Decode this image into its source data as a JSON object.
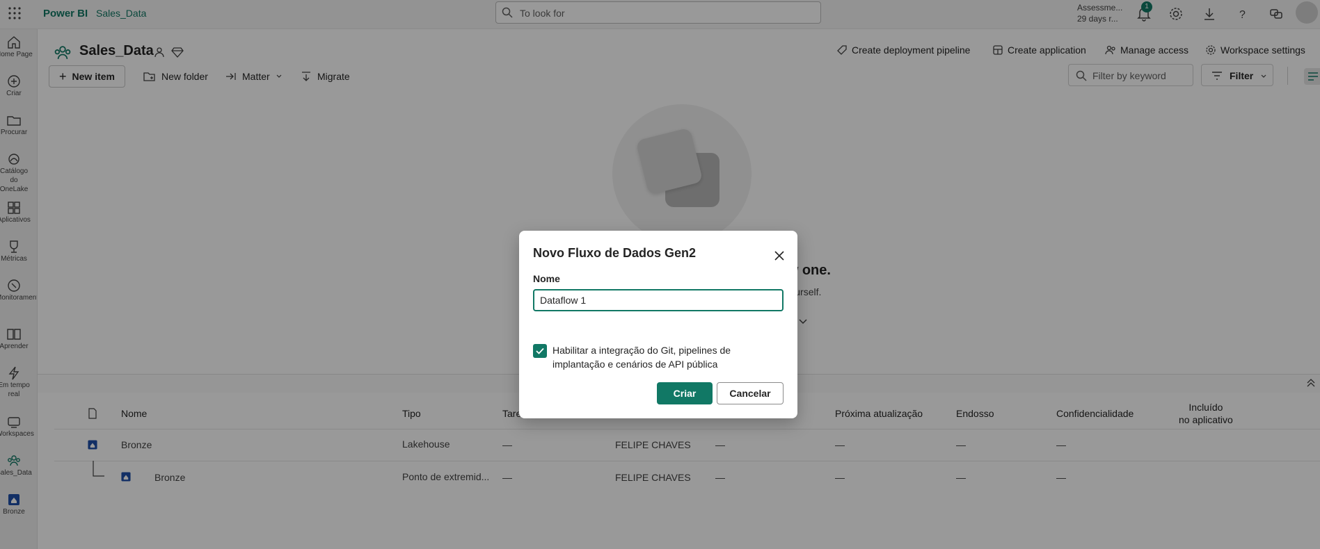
{
  "topbar": {
    "brand": "Power BI",
    "workspace": "Sales_Data",
    "search_placeholder": "To look for",
    "trial_line1": "Assessme...",
    "trial_line2": "29 days r...",
    "notification_count": "1"
  },
  "rail": {
    "items": [
      {
        "label": "Home Page",
        "icon": "home-icon"
      },
      {
        "label": "Criar",
        "icon": "plus-circle-icon"
      },
      {
        "label": "Procurar",
        "icon": "folder-icon"
      },
      {
        "label": "Catálogo do OneLake",
        "icon": "onelake-icon"
      },
      {
        "label": "Aplicativos",
        "icon": "apps-icon"
      },
      {
        "label": "Métricas",
        "icon": "trophy-icon"
      },
      {
        "label": "Monitoramento",
        "icon": "monitor-icon"
      },
      {
        "label": "Aprender",
        "icon": "book-icon"
      },
      {
        "label": "Em tempo real",
        "icon": "lightning-icon"
      },
      {
        "label": "Workspaces",
        "icon": "workspaces-icon"
      },
      {
        "label": "Sales_Data",
        "icon": "workspace-people-icon"
      },
      {
        "label": "Bronze",
        "icon": "lakehouse-icon"
      }
    ]
  },
  "workspace": {
    "title": "Sales_Data",
    "actions": {
      "deploy": "Create deployment pipeline",
      "app": "Create application",
      "access": "Manage access",
      "settings": "Workspace settings"
    },
    "toolbar": {
      "new_item": "New item",
      "new_folder": "New folder",
      "matter": "Matter",
      "migrate": "Migrate"
    },
    "filter_placeholder": "Filter by keyword",
    "filter_label": "Filter"
  },
  "empty_state": {
    "title": "Choose an existing item or create a new one.",
    "subtitle": "Select an item from the list or create a new existing one yourself."
  },
  "table": {
    "headers": {
      "name": "Nome",
      "type": "Tipo",
      "task": "Tare",
      "next_refresh": "Próxima atualização",
      "endorsement": "Endosso",
      "sensitivity": "Confidencialidade",
      "included_1": "Incluído",
      "included_2": "no aplicativo"
    },
    "rows": [
      {
        "name": "Bronze",
        "type": "Lakehouse",
        "task": "—",
        "owner": "FELIPE CHAVES",
        "refreshed": "—",
        "next": "—",
        "endorsement": "—",
        "sensitivity": "—"
      },
      {
        "name": "Bronze",
        "type": "Ponto de extremid...",
        "task": "—",
        "owner": "FELIPE CHAVES",
        "refreshed": "—",
        "next": "—",
        "endorsement": "—",
        "sensitivity": "—"
      }
    ]
  },
  "dialog": {
    "title": "Novo Fluxo de Dados Gen2",
    "name_label": "Nome",
    "name_value": "Dataflow 1",
    "checkbox_checked": true,
    "checkbox_label": "Habilitar a integração do Git, pipelines de implantação e cenários de API pública",
    "create": "Criar",
    "cancel": "Cancelar"
  },
  "colors": {
    "accent": "#117865",
    "overlay": "rgba(0,0,0,0.40)"
  }
}
